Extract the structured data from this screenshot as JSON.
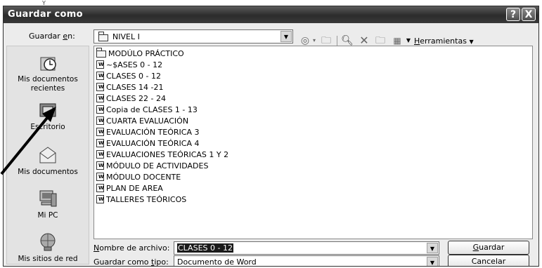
{
  "corner_mark": "Y",
  "dialog": {
    "title": "Guardar como",
    "help_label": "?",
    "close_label": "X"
  },
  "lookin": {
    "label_pre": "Guardar ",
    "label_key": "e",
    "label_post": "n:",
    "value": "NIVEL I"
  },
  "toolbar": {
    "tools_key": "H",
    "tools_rest": "erramientas",
    "icons": [
      "back-icon",
      "up-folder-icon",
      "search-web-icon",
      "delete-icon",
      "new-folder-icon",
      "views-icon"
    ]
  },
  "places": [
    {
      "label": "Mis documentos recientes",
      "icon": "recent-documents-icon"
    },
    {
      "label": "Escritorio",
      "icon": "desktop-icon"
    },
    {
      "label": "Mis documentos",
      "icon": "my-documents-icon"
    },
    {
      "label": "Mi PC",
      "icon": "my-computer-icon"
    },
    {
      "label": "Mis sitios de red",
      "icon": "network-places-icon"
    }
  ],
  "files": [
    {
      "name": "MODÚLO PRÁCTICO",
      "type": "folder"
    },
    {
      "name": "~$ASES 0 - 12",
      "type": "word"
    },
    {
      "name": "CLASES 0 - 12",
      "type": "word"
    },
    {
      "name": "CLASES 14 -21",
      "type": "word"
    },
    {
      "name": "CLASES 22 - 24",
      "type": "word"
    },
    {
      "name": "Copia de CLASES 1 - 13",
      "type": "word"
    },
    {
      "name": "CUARTA EVALUACIÓN",
      "type": "word"
    },
    {
      "name": "EVALUACIÓN TEÓRICA 3",
      "type": "word"
    },
    {
      "name": "EVALUACIÓN TEÓRICA 4",
      "type": "word"
    },
    {
      "name": "EVALUACIONES TEÓRICAS 1 Y 2",
      "type": "word"
    },
    {
      "name": "MÓDULO DE ACTIVIDADES",
      "type": "word"
    },
    {
      "name": "MÓDULO DOCENTE",
      "type": "word"
    },
    {
      "name": "PLAN DE AREA",
      "type": "word"
    },
    {
      "name": "TALLERES TEÓRICOS",
      "type": "word"
    }
  ],
  "filename": {
    "label_key": "N",
    "label_rest": "ombre de archivo:",
    "value": "CLASES 0 - 12"
  },
  "filetype": {
    "label_pre": "Guardar como ",
    "label_key": "t",
    "label_post": "ipo:",
    "value": "Documento de Word"
  },
  "buttons": {
    "save_key": "G",
    "save_rest": "uardar",
    "cancel": "Cancelar"
  }
}
